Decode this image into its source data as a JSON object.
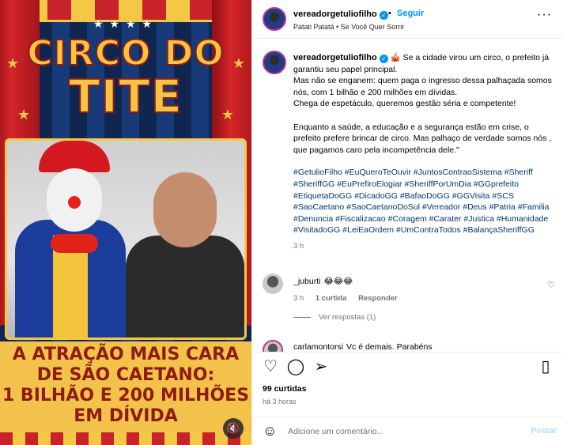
{
  "post_image": {
    "title_line1": "CIRCO DO",
    "title_line2": "TITE",
    "banner_line1": "A ATRAÇÃO MAIS CARA",
    "banner_line2": "DE SÃO CAETANO:",
    "banner_line3": "1 BILHÃO E 200 MILHÕES",
    "banner_line4": "EM DÍVIDA",
    "mute_icon": "speaker-muted-icon"
  },
  "header": {
    "username": "vereadorgetuliofilho",
    "follow_label": "Seguir",
    "audio": "Patati Patatá • Se Você Quer Sorrir"
  },
  "caption": {
    "username": "vereadorgetuliofilho",
    "text": " 🎪 Se a cidade virou um circo, o prefeito já garantiu seu papel principal.\nMas não se enganem: quem paga o ingresso dessa palhaçada somos nós, com 1 bilhão e 200 milhões em dívidas.\nChega de espetáculo, queremos gestão séria e competente!\n\nEnquanto a saúde, a educação e a segurança estão em crise, o prefeito prefere brincar de circo. Mas palhaço de verdade somos nós , que pagamos caro pela incompetência dele.\"",
    "hashtags": [
      "#GetulioFilho",
      "#EuQueroTeOuvir",
      "#JuntosContraoSistema",
      "#Sheriff",
      "#SheriffGG",
      "#EuPrefiroElogiar",
      "#SheriffPorUmDia",
      "#GGprefeito",
      "#EtiquetaDoGG",
      "#DicadoGG",
      "#BafaoDoGG",
      "#GGVisita",
      "#SCS",
      "#SaoCaetano",
      "#SaoCaetanoDoSul",
      "#Vereador",
      "#Deus",
      "#Patria",
      "#Familia",
      "#Denuncia",
      "#Fiscalizacao",
      "#Coragem",
      "#Carater",
      "#Justica",
      "#Humanidade",
      "#VisitadoGG",
      "#LeiEaOrdem",
      "#UmContraTodos",
      "#BalançaSheriffGG"
    ],
    "time": "3 h"
  },
  "comments": [
    {
      "username": "_juburti",
      "text": "😂😂😂",
      "time": "3 h",
      "likes": "1 curtida",
      "reply_label": "Responder",
      "view_replies": "Ver respostas (1)"
    },
    {
      "username": "carlamontorsi",
      "text": "Vc é demais. Parabéns"
    }
  ],
  "actions": {
    "likes": "99 curtidas",
    "posted": "há 3 horas"
  },
  "comment_box": {
    "placeholder": "Adicione um comentário...",
    "post_label": "Postar"
  }
}
